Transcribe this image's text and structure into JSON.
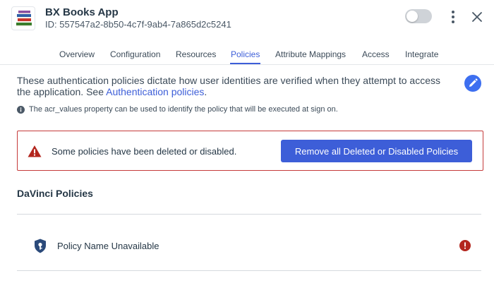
{
  "header": {
    "app_name": "BX Books App",
    "app_id": "ID: 557547a2-8b50-4c7f-9ab4-7a865d2c5241",
    "logo_icon": "books-icon",
    "enabled": false
  },
  "tabs": [
    {
      "label": "Overview",
      "active": false
    },
    {
      "label": "Configuration",
      "active": false
    },
    {
      "label": "Resources",
      "active": false
    },
    {
      "label": "Policies",
      "active": true
    },
    {
      "label": "Attribute Mappings",
      "active": false
    },
    {
      "label": "Access",
      "active": false
    },
    {
      "label": "Integrate",
      "active": false
    }
  ],
  "policies": {
    "description": "These authentication policies dictate how user identities are verified when they attempt to access the application. See ",
    "description_link": "Authentication policies",
    "description_end": ".",
    "hint": "The acr_values property can be used to identify the policy that will be executed at sign on.",
    "alert": {
      "message": "Some policies have been deleted or disabled.",
      "button_label": "Remove all Deleted or Disabled Policies"
    },
    "section_title": "DaVinci Policies",
    "items": [
      {
        "name": "Policy Name Unavailable",
        "icon": "shield-key-icon",
        "status_icon": "error-icon"
      }
    ]
  },
  "colors": {
    "accent": "#3d5ed8",
    "danger": "#c53a3a",
    "text": "#253746",
    "policy_icon": "#2b4a7a"
  }
}
